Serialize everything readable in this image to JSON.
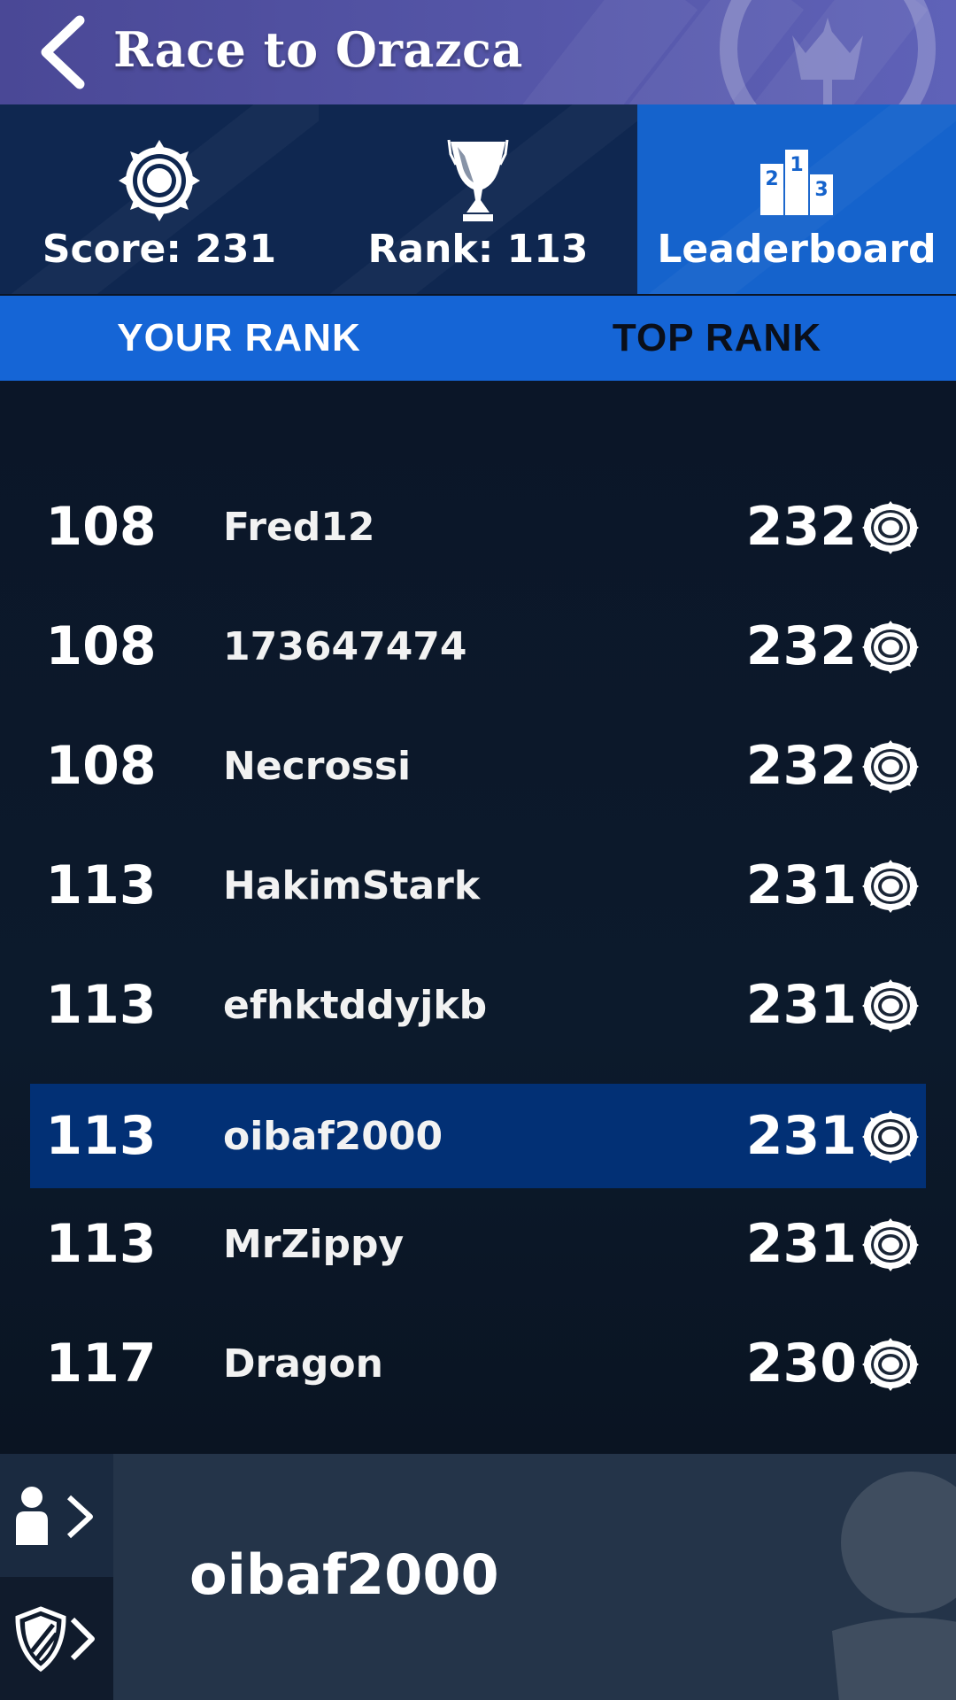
{
  "header": {
    "title": "Race to Orazca",
    "back_icon": "chevron-left-icon",
    "emblem_icon": "guild-emblem-icon",
    "background_color": "#5053a3"
  },
  "stats": {
    "score_label": "Score: 231",
    "rank_label": "Rank: 113",
    "leaderboard_label": "Leaderboard",
    "score_icon": "medallion-icon",
    "rank_icon": "trophy-icon",
    "leaderboard_icon": "podium-icon",
    "active_color": "#1563cc"
  },
  "tabs": {
    "your_rank": "YOUR RANK",
    "top_rank": "TOP RANK",
    "selected": "YOUR RANK"
  },
  "leaderboard": {
    "rows": [
      {
        "rank": "108",
        "name": "Fred12",
        "score": "232"
      },
      {
        "rank": "108",
        "name": "173647474",
        "score": "232"
      },
      {
        "rank": "108",
        "name": "Necrossi",
        "score": "232"
      },
      {
        "rank": "113",
        "name": "HakimStark",
        "score": "231"
      },
      {
        "rank": "113",
        "name": "efhktddyjkb",
        "score": "231"
      },
      {
        "rank": "113",
        "name": "oibaf2000",
        "score": "231"
      },
      {
        "rank": "113",
        "name": "MrZippy",
        "score": "231"
      },
      {
        "rank": "117",
        "name": "Dragon",
        "score": "230"
      }
    ],
    "highlighted_player": "oibaf2000",
    "highlight_color": "#023075",
    "score_icon": "medallion-icon"
  },
  "bottom": {
    "username": "oibaf2000",
    "profile_icon": "person-chevron-icon",
    "guild_icon": "shield-chevron-icon"
  }
}
